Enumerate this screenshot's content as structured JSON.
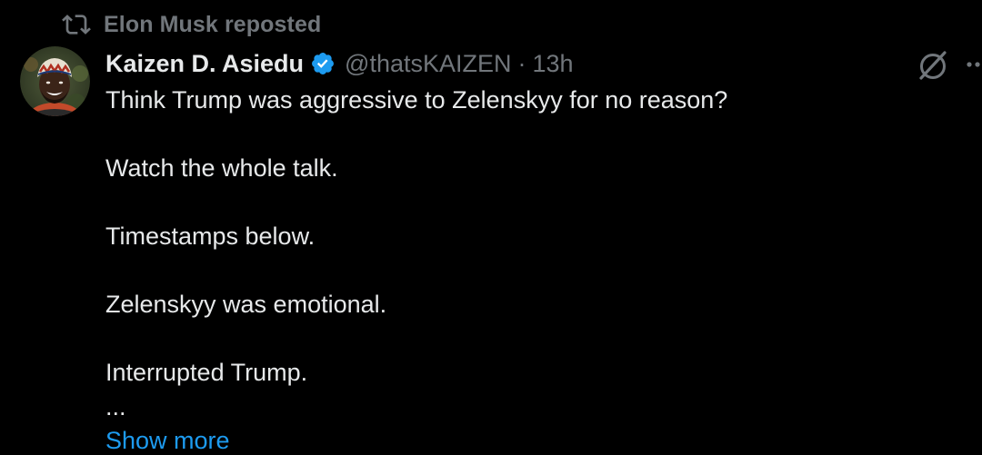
{
  "repost": {
    "icon": "repost-icon",
    "text": "Elon Musk reposted"
  },
  "author": {
    "avatar": "avatar",
    "display_name": "Kaizen D. Asiedu",
    "verified_icon": "verified-badge-icon",
    "handle": "@thatsKAIZEN",
    "separator": "·",
    "time": "13h"
  },
  "actions": {
    "grok_icon": "grok-icon",
    "more_icon": "more-icon"
  },
  "tweet": {
    "lines": [
      "Think Trump was aggressive to Zelenskyy for no reason?",
      "Watch the whole talk.",
      "Timestamps below.",
      "Zelenskyy was emotional.",
      "Interrupted Trump.",
      "..."
    ],
    "show_more": "Show more"
  },
  "colors": {
    "background": "#000000",
    "primary_text": "#e7e9ea",
    "secondary_text": "#71767b",
    "link": "#1d9bf0",
    "verified": "#1d9bf0"
  }
}
